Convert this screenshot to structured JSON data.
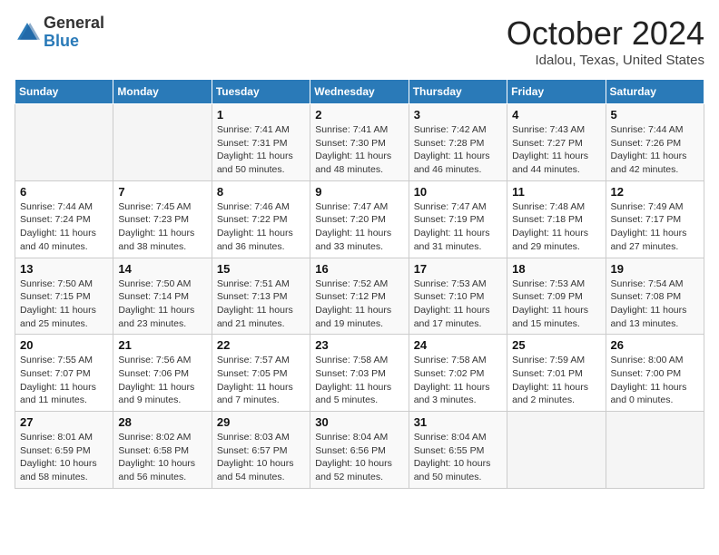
{
  "header": {
    "logo": {
      "general": "General",
      "blue": "Blue"
    },
    "title": "October 2024",
    "location": "Idalou, Texas, United States"
  },
  "days_of_week": [
    "Sunday",
    "Monday",
    "Tuesday",
    "Wednesday",
    "Thursday",
    "Friday",
    "Saturday"
  ],
  "weeks": [
    [
      {
        "day": "",
        "sunrise": "",
        "sunset": "",
        "daylight": ""
      },
      {
        "day": "",
        "sunrise": "",
        "sunset": "",
        "daylight": ""
      },
      {
        "day": "1",
        "sunrise": "Sunrise: 7:41 AM",
        "sunset": "Sunset: 7:31 PM",
        "daylight": "Daylight: 11 hours and 50 minutes."
      },
      {
        "day": "2",
        "sunrise": "Sunrise: 7:41 AM",
        "sunset": "Sunset: 7:30 PM",
        "daylight": "Daylight: 11 hours and 48 minutes."
      },
      {
        "day": "3",
        "sunrise": "Sunrise: 7:42 AM",
        "sunset": "Sunset: 7:28 PM",
        "daylight": "Daylight: 11 hours and 46 minutes."
      },
      {
        "day": "4",
        "sunrise": "Sunrise: 7:43 AM",
        "sunset": "Sunset: 7:27 PM",
        "daylight": "Daylight: 11 hours and 44 minutes."
      },
      {
        "day": "5",
        "sunrise": "Sunrise: 7:44 AM",
        "sunset": "Sunset: 7:26 PM",
        "daylight": "Daylight: 11 hours and 42 minutes."
      }
    ],
    [
      {
        "day": "6",
        "sunrise": "Sunrise: 7:44 AM",
        "sunset": "Sunset: 7:24 PM",
        "daylight": "Daylight: 11 hours and 40 minutes."
      },
      {
        "day": "7",
        "sunrise": "Sunrise: 7:45 AM",
        "sunset": "Sunset: 7:23 PM",
        "daylight": "Daylight: 11 hours and 38 minutes."
      },
      {
        "day": "8",
        "sunrise": "Sunrise: 7:46 AM",
        "sunset": "Sunset: 7:22 PM",
        "daylight": "Daylight: 11 hours and 36 minutes."
      },
      {
        "day": "9",
        "sunrise": "Sunrise: 7:47 AM",
        "sunset": "Sunset: 7:20 PM",
        "daylight": "Daylight: 11 hours and 33 minutes."
      },
      {
        "day": "10",
        "sunrise": "Sunrise: 7:47 AM",
        "sunset": "Sunset: 7:19 PM",
        "daylight": "Daylight: 11 hours and 31 minutes."
      },
      {
        "day": "11",
        "sunrise": "Sunrise: 7:48 AM",
        "sunset": "Sunset: 7:18 PM",
        "daylight": "Daylight: 11 hours and 29 minutes."
      },
      {
        "day": "12",
        "sunrise": "Sunrise: 7:49 AM",
        "sunset": "Sunset: 7:17 PM",
        "daylight": "Daylight: 11 hours and 27 minutes."
      }
    ],
    [
      {
        "day": "13",
        "sunrise": "Sunrise: 7:50 AM",
        "sunset": "Sunset: 7:15 PM",
        "daylight": "Daylight: 11 hours and 25 minutes."
      },
      {
        "day": "14",
        "sunrise": "Sunrise: 7:50 AM",
        "sunset": "Sunset: 7:14 PM",
        "daylight": "Daylight: 11 hours and 23 minutes."
      },
      {
        "day": "15",
        "sunrise": "Sunrise: 7:51 AM",
        "sunset": "Sunset: 7:13 PM",
        "daylight": "Daylight: 11 hours and 21 minutes."
      },
      {
        "day": "16",
        "sunrise": "Sunrise: 7:52 AM",
        "sunset": "Sunset: 7:12 PM",
        "daylight": "Daylight: 11 hours and 19 minutes."
      },
      {
        "day": "17",
        "sunrise": "Sunrise: 7:53 AM",
        "sunset": "Sunset: 7:10 PM",
        "daylight": "Daylight: 11 hours and 17 minutes."
      },
      {
        "day": "18",
        "sunrise": "Sunrise: 7:53 AM",
        "sunset": "Sunset: 7:09 PM",
        "daylight": "Daylight: 11 hours and 15 minutes."
      },
      {
        "day": "19",
        "sunrise": "Sunrise: 7:54 AM",
        "sunset": "Sunset: 7:08 PM",
        "daylight": "Daylight: 11 hours and 13 minutes."
      }
    ],
    [
      {
        "day": "20",
        "sunrise": "Sunrise: 7:55 AM",
        "sunset": "Sunset: 7:07 PM",
        "daylight": "Daylight: 11 hours and 11 minutes."
      },
      {
        "day": "21",
        "sunrise": "Sunrise: 7:56 AM",
        "sunset": "Sunset: 7:06 PM",
        "daylight": "Daylight: 11 hours and 9 minutes."
      },
      {
        "day": "22",
        "sunrise": "Sunrise: 7:57 AM",
        "sunset": "Sunset: 7:05 PM",
        "daylight": "Daylight: 11 hours and 7 minutes."
      },
      {
        "day": "23",
        "sunrise": "Sunrise: 7:58 AM",
        "sunset": "Sunset: 7:03 PM",
        "daylight": "Daylight: 11 hours and 5 minutes."
      },
      {
        "day": "24",
        "sunrise": "Sunrise: 7:58 AM",
        "sunset": "Sunset: 7:02 PM",
        "daylight": "Daylight: 11 hours and 3 minutes."
      },
      {
        "day": "25",
        "sunrise": "Sunrise: 7:59 AM",
        "sunset": "Sunset: 7:01 PM",
        "daylight": "Daylight: 11 hours and 2 minutes."
      },
      {
        "day": "26",
        "sunrise": "Sunrise: 8:00 AM",
        "sunset": "Sunset: 7:00 PM",
        "daylight": "Daylight: 11 hours and 0 minutes."
      }
    ],
    [
      {
        "day": "27",
        "sunrise": "Sunrise: 8:01 AM",
        "sunset": "Sunset: 6:59 PM",
        "daylight": "Daylight: 10 hours and 58 minutes."
      },
      {
        "day": "28",
        "sunrise": "Sunrise: 8:02 AM",
        "sunset": "Sunset: 6:58 PM",
        "daylight": "Daylight: 10 hours and 56 minutes."
      },
      {
        "day": "29",
        "sunrise": "Sunrise: 8:03 AM",
        "sunset": "Sunset: 6:57 PM",
        "daylight": "Daylight: 10 hours and 54 minutes."
      },
      {
        "day": "30",
        "sunrise": "Sunrise: 8:04 AM",
        "sunset": "Sunset: 6:56 PM",
        "daylight": "Daylight: 10 hours and 52 minutes."
      },
      {
        "day": "31",
        "sunrise": "Sunrise: 8:04 AM",
        "sunset": "Sunset: 6:55 PM",
        "daylight": "Daylight: 10 hours and 50 minutes."
      },
      {
        "day": "",
        "sunrise": "",
        "sunset": "",
        "daylight": ""
      },
      {
        "day": "",
        "sunrise": "",
        "sunset": "",
        "daylight": ""
      }
    ]
  ]
}
